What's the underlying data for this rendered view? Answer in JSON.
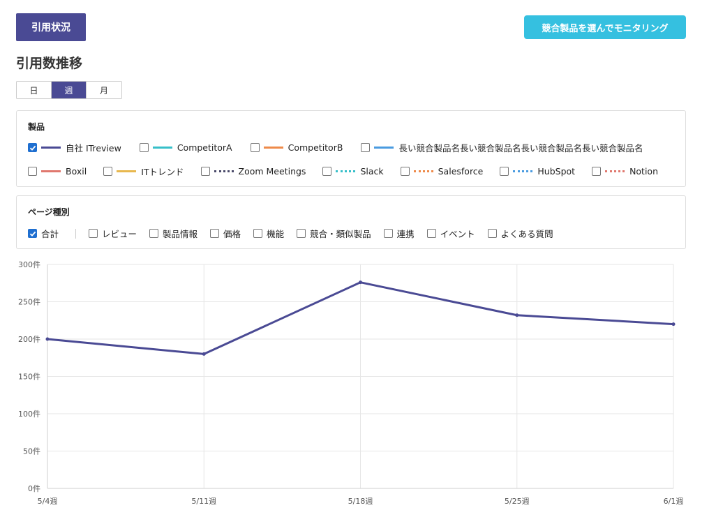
{
  "header": {
    "tab_label": "引用状況",
    "monitor_button": "競合製品を選んでモニタリング"
  },
  "section": {
    "title": "引用数推移"
  },
  "period": {
    "options": [
      "日",
      "週",
      "月"
    ],
    "selected": "週"
  },
  "products": {
    "label": "製品",
    "items": [
      {
        "label": "自社 ITreview",
        "checked": true,
        "color": "#4a4a94",
        "style": "solid"
      },
      {
        "label": "CompetitorA",
        "checked": false,
        "color": "#37bfc9",
        "style": "solid"
      },
      {
        "label": "CompetitorB",
        "checked": false,
        "color": "#ee8a4a",
        "style": "solid"
      },
      {
        "label": "長い競合製品名長い競合製品名長い競合製品名長い競合製品名",
        "checked": false,
        "color": "#4a9be0",
        "style": "solid"
      },
      {
        "label": "Boxil",
        "checked": false,
        "color": "#e0786e",
        "style": "solid"
      },
      {
        "label": "ITトレンド",
        "checked": false,
        "color": "#e8b84e",
        "style": "solid"
      },
      {
        "label": "Zoom Meetings",
        "checked": false,
        "color": "#4a4a6a",
        "style": "dotted"
      },
      {
        "label": "Slack",
        "checked": false,
        "color": "#37bfc9",
        "style": "dotted"
      },
      {
        "label": "Salesforce",
        "checked": false,
        "color": "#ee8a4a",
        "style": "dotted"
      },
      {
        "label": "HubSpot",
        "checked": false,
        "color": "#4a9be0",
        "style": "dotted"
      },
      {
        "label": "Notion",
        "checked": false,
        "color": "#e0786e",
        "style": "dotted"
      }
    ]
  },
  "page_types": {
    "label": "ページ種別",
    "total": {
      "label": "合計",
      "checked": true
    },
    "items": [
      {
        "label": "レビュー",
        "checked": false
      },
      {
        "label": "製品情報",
        "checked": false
      },
      {
        "label": "価格",
        "checked": false
      },
      {
        "label": "機能",
        "checked": false
      },
      {
        "label": "競合・類似製品",
        "checked": false
      },
      {
        "label": "連携",
        "checked": false
      },
      {
        "label": "イベント",
        "checked": false
      },
      {
        "label": "よくある質問",
        "checked": false
      }
    ]
  },
  "chart_data": {
    "type": "line",
    "categories": [
      "5/4週",
      "5/11週",
      "5/18週",
      "5/25週",
      "6/1週"
    ],
    "series": [
      {
        "name": "自社 ITreview",
        "color": "#4a4a94",
        "values": [
          200,
          180,
          276,
          232,
          220
        ]
      }
    ],
    "ylim": [
      0,
      300
    ],
    "yticks": [
      0,
      50,
      100,
      150,
      200,
      250,
      300
    ],
    "ytick_labels": [
      "0件",
      "50件",
      "100件",
      "150件",
      "200件",
      "250件",
      "300件"
    ],
    "grid": true
  }
}
